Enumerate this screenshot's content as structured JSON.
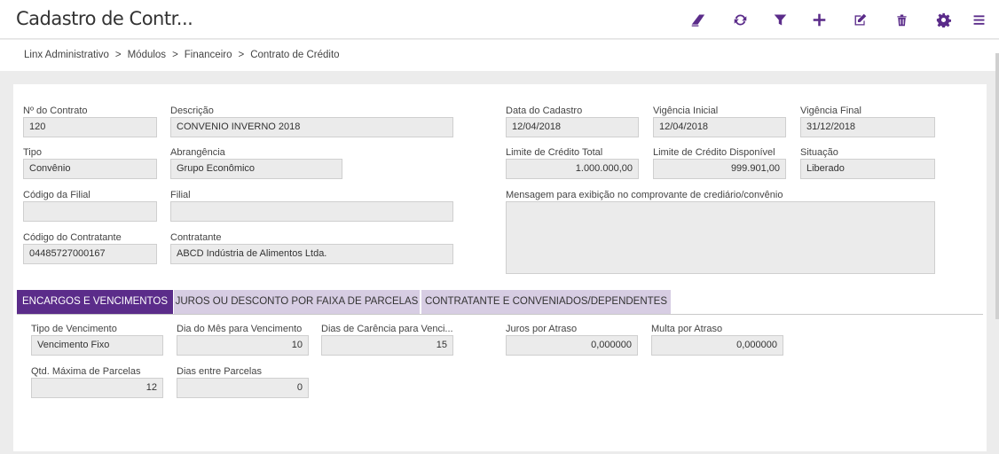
{
  "header": {
    "title": "Cadastro de Contr...",
    "icons": [
      "eraser-icon",
      "refresh-icon",
      "filter-icon",
      "plus-icon",
      "edit-icon",
      "trash-icon",
      "gear-icon",
      "menu-icon"
    ]
  },
  "breadcrumb": [
    "Linx Administrativo",
    "Módulos",
    "Financeiro",
    "Contrato de Crédito"
  ],
  "breadcrumb_separator": ">",
  "form": {
    "numero_contrato": {
      "label": "Nº do Contrato",
      "value": "120"
    },
    "descricao": {
      "label": "Descrição",
      "value": "CONVENIO INVERNO 2018"
    },
    "data_cadastro": {
      "label": "Data do Cadastro",
      "value": "12/04/2018"
    },
    "vigencia_inicial": {
      "label": "Vigência Inicial",
      "value": "12/04/2018"
    },
    "vigencia_final": {
      "label": "Vigência Final",
      "value": "31/12/2018"
    },
    "tipo": {
      "label": "Tipo",
      "value": "Convênio"
    },
    "abrangencia": {
      "label": "Abrangência",
      "value": "Grupo Econômico"
    },
    "limite_total": {
      "label": "Limite de Crédito Total",
      "value": "1.000.000,00"
    },
    "limite_disponivel": {
      "label": "Limite de Crédito Disponível",
      "value": "999.901,00"
    },
    "situacao": {
      "label": "Situação",
      "value": "Liberado"
    },
    "codigo_filial": {
      "label": "Código da Filial",
      "value": ""
    },
    "filial": {
      "label": "Filial",
      "value": ""
    },
    "mensagem": {
      "label": "Mensagem para exibição no comprovante de crediário/convênio",
      "value": ""
    },
    "codigo_contratante": {
      "label": "Código do Contratante",
      "value": "04485727000167"
    },
    "contratante": {
      "label": "Contratante",
      "value": "ABCD Indústria de Alimentos Ltda."
    }
  },
  "tabs": [
    {
      "label": "ENCARGOS E VENCIMENTOS",
      "active": true
    },
    {
      "label": "JUROS OU DESCONTO POR FAIXA DE PARCELAS",
      "active": false
    },
    {
      "label": "CONTRATANTE E CONVENIADOS/DEPENDENTES",
      "active": false
    }
  ],
  "encargos": {
    "tipo_vencimento": {
      "label": "Tipo de Vencimento",
      "value": "Vencimento Fixo"
    },
    "dia_mes": {
      "label": "Dia do Mês para Vencimento",
      "value": "10"
    },
    "dias_carencia": {
      "label": "Dias de Carência para Venci...",
      "value": "15"
    },
    "juros_atraso": {
      "label": "Juros por Atraso",
      "value": "0,000000"
    },
    "multa_atraso": {
      "label": "Multa por Atraso",
      "value": "0,000000"
    },
    "qtd_max_parcelas": {
      "label": "Qtd. Máxima de Parcelas",
      "value": "12"
    },
    "dias_entre_parcelas": {
      "label": "Dias entre Parcelas",
      "value": "0"
    }
  },
  "colors": {
    "accent": "#5b2c8a",
    "tab_inactive": "#d7cde3",
    "field_bg": "#ebebeb"
  }
}
